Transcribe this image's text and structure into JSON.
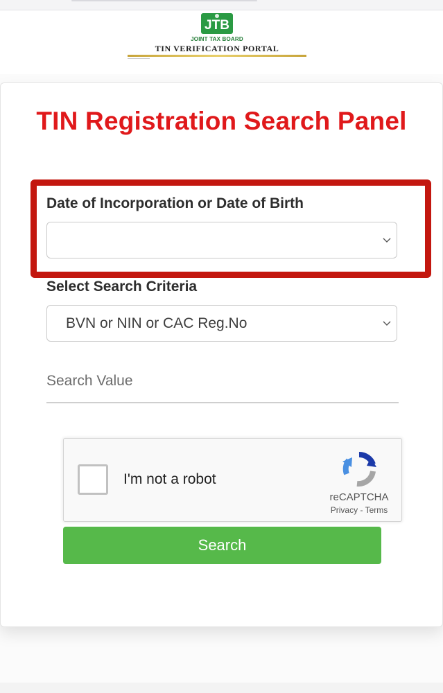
{
  "header": {
    "logo_badge_text": "JTB",
    "logo_org": "JOINT TAX BOARD",
    "logo_portal": "TIN VERIFICATION PORTAL"
  },
  "panel": {
    "title": "TIN Registration Search Panel",
    "date_field": {
      "label": "Date of Incorporation or Date of Birth",
      "value": ""
    },
    "criteria_field": {
      "label": "Select Search Criteria",
      "selected": "BVN or NIN or CAC Reg.No"
    },
    "search_value": {
      "placeholder": "Search Value",
      "value": ""
    },
    "recaptcha": {
      "label": "I'm not a robot",
      "brand": "reCAPTCHA",
      "privacy": "Privacy",
      "separator": " - ",
      "terms": "Terms"
    },
    "search_button_label": "Search"
  },
  "colors": {
    "title_red": "#e0191b",
    "highlight_red": "#c3170f",
    "button_green": "#56b94a",
    "logo_green": "#1f7a33"
  },
  "icons": {
    "dropdown": "chevron-down-icon",
    "captcha": "recaptcha-icon",
    "logo": "jtb-logo-icon"
  }
}
